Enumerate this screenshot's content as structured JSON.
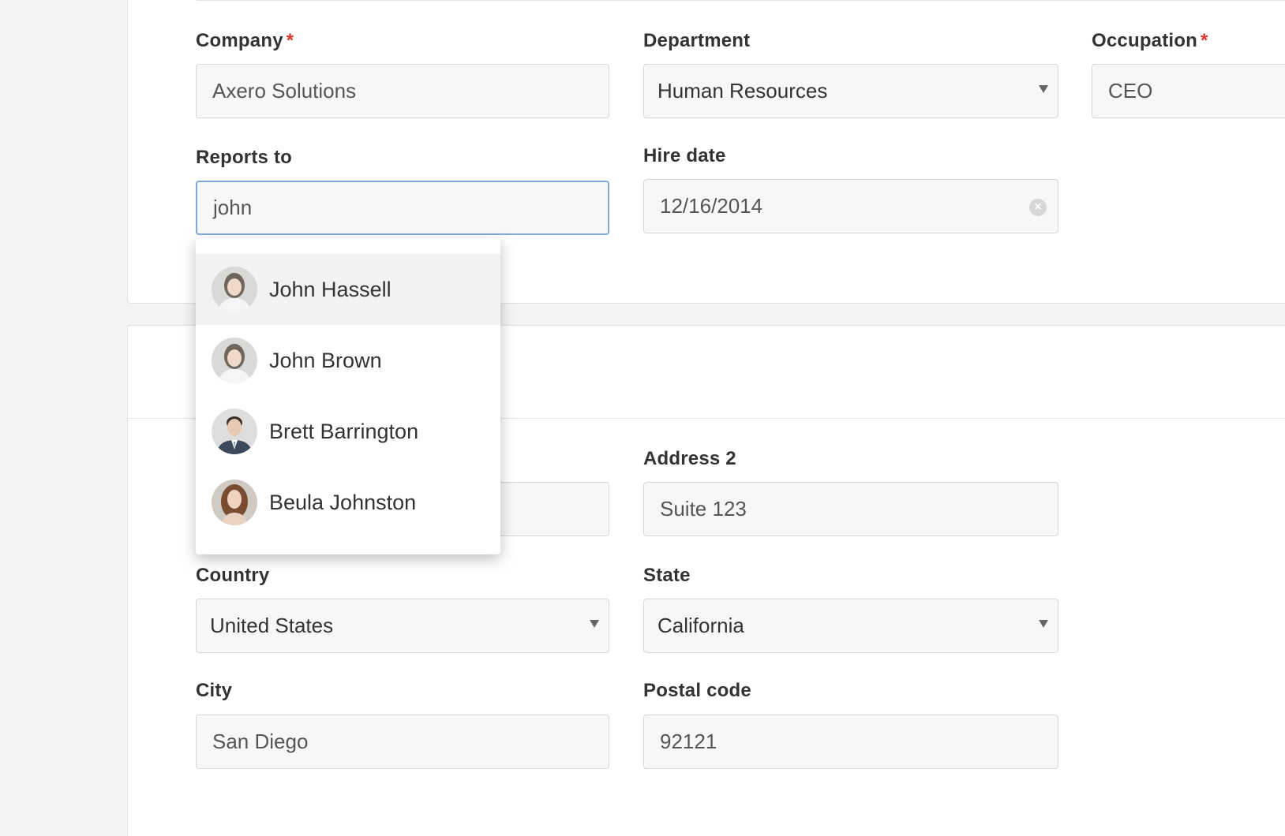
{
  "form": {
    "company": {
      "label": "Company",
      "required": "*",
      "value": "Axero Solutions"
    },
    "department": {
      "label": "Department",
      "value": "Human Resources"
    },
    "occupation": {
      "label": "Occupation",
      "required": "*",
      "value": "CEO"
    },
    "reports_to": {
      "label": "Reports to",
      "value": "john"
    },
    "hire_date": {
      "label": "Hire date",
      "value": "12/16/2014"
    },
    "address2": {
      "label": "Address 2",
      "value": "Suite 123"
    },
    "country": {
      "label": "Country",
      "value": "United States"
    },
    "state": {
      "label": "State",
      "value": "California"
    },
    "city": {
      "label": "City",
      "value": "San Diego"
    },
    "postal_code": {
      "label": "Postal code",
      "value": "92121"
    }
  },
  "dropdown": {
    "items": [
      {
        "name": "John Hassell",
        "avatar": "woman-avatar-icon"
      },
      {
        "name": "John Brown",
        "avatar": "woman-avatar-icon"
      },
      {
        "name": "Brett Barrington",
        "avatar": "man-avatar-icon"
      },
      {
        "name": "Beula Johnston",
        "avatar": "woman-avatar-icon"
      }
    ]
  },
  "colors": {
    "required": "#d9342b",
    "focus_border": "#7fa9d4",
    "hover_row": "#f2f2f2"
  }
}
